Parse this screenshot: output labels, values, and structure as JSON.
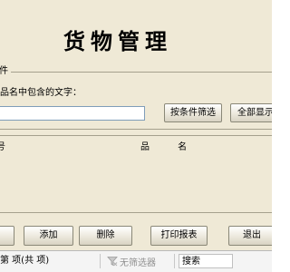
{
  "form": {
    "title": "货物管理",
    "filter_group_legend": "件",
    "filter_prompt": "品名中包含的文字：",
    "filter_input_value": "",
    "filter_button": "按条件筛选",
    "show_all_button": "全部显示",
    "columns": {
      "code": "号",
      "name": "品 名"
    },
    "buttons": {
      "add": "添加",
      "delete": "删除",
      "print_report": "打印报表",
      "exit": "退出"
    }
  },
  "navbar": {
    "record_text": "第 项(共 项)",
    "filter_status": "无筛选器",
    "search_placeholder": "搜索"
  },
  "icons": {
    "filter_status": "funnel-filter-icon"
  }
}
